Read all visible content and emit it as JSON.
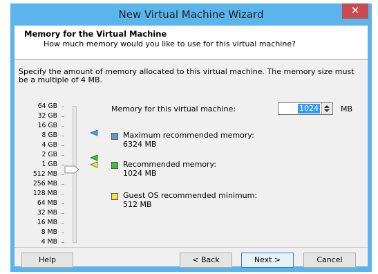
{
  "window": {
    "title": "New Virtual Machine Wizard",
    "close_glyph": "✕"
  },
  "header": {
    "title": "Memory for the Virtual Machine",
    "subtitle": "How much memory would you like to use for this virtual machine?"
  },
  "description": "Specify the amount of memory allocated to this virtual machine. The memory size must be a multiple of 4 MB.",
  "scale": {
    "ticks": [
      "64 GB",
      "32 GB",
      "16 GB",
      "8 GB",
      "4 GB",
      "2 GB",
      "1 GB",
      "512 MB",
      "256 MB",
      "128 MB",
      "64 MB",
      "32 MB",
      "16 MB",
      "8 MB",
      "4 MB"
    ],
    "selected": "1 GB"
  },
  "memory": {
    "label": "Memory for this virtual machine:",
    "value": "1024",
    "unit": "MB"
  },
  "legend": [
    {
      "title": "Maximum recommended memory:",
      "value": "6324 MB",
      "color": "#5b9bd5"
    },
    {
      "title": "Recommended memory:",
      "value": "1024 MB",
      "color": "#3cc13c"
    },
    {
      "title": "Guest OS recommended minimum:",
      "value": "512 MB",
      "color": "#f4e342"
    }
  ],
  "buttons": {
    "help": "Help",
    "back": "< Back",
    "next": "Next >",
    "cancel": "Cancel"
  }
}
